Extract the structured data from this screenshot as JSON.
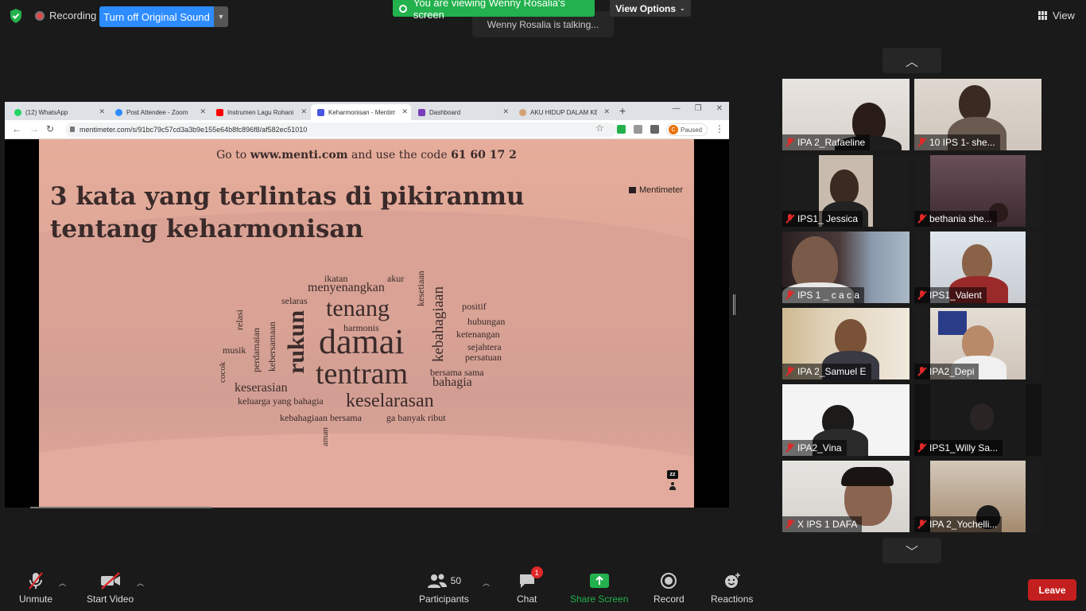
{
  "topbar": {
    "recording_label": "Recording",
    "sound_button": "Turn off Original Sound",
    "viewing_banner": "You are viewing Wenny Rosalia's screen",
    "view_options": "View Options",
    "talking": "Wenny Rosalia is talking...",
    "view_label": "View"
  },
  "browser": {
    "tabs": [
      {
        "label": "(12) WhatsApp",
        "favicon_color": "#25d366"
      },
      {
        "label": "Post Attendee - Zoom",
        "favicon_color": "#2d8cff"
      },
      {
        "label": "Instrumen Lagu Rohani",
        "favicon_color": "#ff0000"
      },
      {
        "label": "Keharmonisan - Mentimeter",
        "favicon_color": "#4a56e2"
      },
      {
        "label": "Dashboard",
        "favicon_color": "#7a3db8"
      },
      {
        "label": "AKU HIDUP DALAM KE",
        "favicon_color": "#d4a373"
      }
    ],
    "url": "mentimeter.com/s/91bc79c57cd3a3b9e155e64b8fc896f8/af582ec51010",
    "profile_status": "Paused",
    "profile_initial": "C"
  },
  "slide": {
    "goto_prefix": "Go to ",
    "goto_site": "www.menti.com",
    "goto_middle": " and use the code ",
    "goto_code": "61 60 17 2",
    "brand": "Mentimeter",
    "question": "3 kata yang terlintas di pikiranmu tentang keharmonisan",
    "words": [
      "ikatan",
      "akur",
      "kesetiaan",
      "menyenangkan",
      "selaras",
      "tenang",
      "positif",
      "relasi",
      "harmonis",
      "kebahagiaan",
      "hubungan",
      "perdamaian",
      "kebersamaan",
      "rukun",
      "damai",
      "ketenangan",
      "sejahtera",
      "musik",
      "persatuan",
      "cocok",
      "tentram",
      "bersama sama",
      "bahagia",
      "keserasian",
      "keluarga yang bahagia",
      "keselarasan",
      "kebahagiaan bersama",
      "ga banyak ribut",
      "aman"
    ],
    "sleep_badge": "zz"
  },
  "gallery": {
    "participants": [
      "IPA 2_Rafaeline",
      "10 IPS 1- she...",
      "IPS1_ Jessica",
      "bethania she...",
      "IPS 1 _ c a c a",
      "IPS1_Valent",
      "IPA 2_Samuel E",
      "IPA2_Depi",
      "IPA2_Vina",
      "IPS1_Willy Sa...",
      "X IPS 1 DAFA",
      "IPA 2_Yochelli..."
    ]
  },
  "toolbar": {
    "unmute": "Unmute",
    "start_video": "Start Video",
    "participants_count": "50",
    "participants": "Participants",
    "chat": "Chat",
    "chat_badge": "1",
    "share_screen": "Share Screen",
    "record": "Record",
    "reactions": "Reactions",
    "leave": "Leave"
  },
  "colors": {
    "zoom_blue": "#2d8cff",
    "share_green": "#23b14d",
    "leave_red": "#c41f1f",
    "slide_bg": "#e0a898"
  }
}
